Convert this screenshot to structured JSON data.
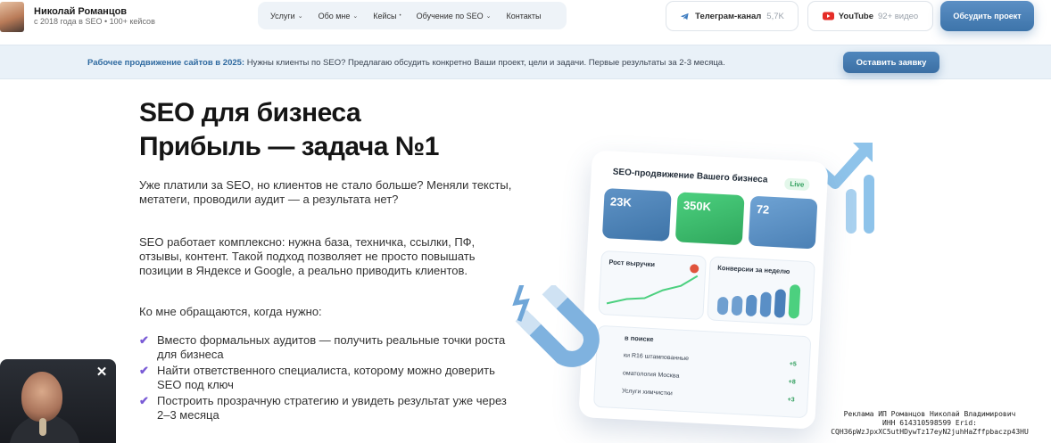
{
  "header": {
    "name": "Николай Романцов",
    "subtitle": "с 2018 года в SEO • 100+ кейсов",
    "nav": [
      {
        "label": "Услуги",
        "has_dropdown": true
      },
      {
        "label": "Обо мне",
        "has_dropdown": true
      },
      {
        "label": "Кейсы",
        "has_dropdown": false
      },
      {
        "label": "Обучение по SEO",
        "has_dropdown": true
      },
      {
        "label": "Контакты",
        "has_dropdown": false
      }
    ],
    "telegram": {
      "label": "Телеграм-канал",
      "count": "5,7K"
    },
    "youtube": {
      "label": "YouTube",
      "count": "92+ видео"
    },
    "cta": "Обсудить проект"
  },
  "promo": {
    "bold": "Рабочее продвижение сайтов в 2025:",
    "text": "Нужны клиенты по SEO? Предлагаю обсудить конкретно Ваши проект, цели и задачи. Первые результаты за 2-3 месяца.",
    "button": "Оставить заявку"
  },
  "hero": {
    "title_line1": "SEO для бизнеса",
    "title_line2": "Прибыль — задача №1",
    "p1": "Уже платили за SEO, но клиентов не стало больше? Меняли тексты, метатеги, проводили аудит — а результата нет?",
    "p2": "SEO работает комплексно: нужна база, техничка, ссылки, ПФ, отзывы, контент. Такой подход позволяет не просто повышать позиции в Яндексе и Google, а реально приводить клиентов.",
    "p3": "Ко мне обращаются, когда нужно:",
    "bullets": [
      "Вместо формальных аудитов — получить реальные точки роста для бизнеса",
      "Найти ответственного специалиста, которому можно доверить SEO под ключ",
      "Построить прозрачную стратегию и увидеть результат уже через 2–3 месяца"
    ]
  },
  "dashboard": {
    "title": "SEO-продвижение Вашего бизнеса",
    "live": "Live",
    "stats": [
      "23K",
      "350K",
      "72"
    ],
    "revenue_title": "Рост выручки",
    "conv_title": "Конверсии за неделю",
    "list_title": "в поиске",
    "list_rows": [
      {
        "label": "ки R16 штампованные",
        "delta": "+5"
      },
      {
        "label": "оматология Москва",
        "delta": "+8"
      },
      {
        "label": "Услуги химчистки",
        "delta": "+3"
      }
    ]
  },
  "ad": {
    "line1": "Реклама ИП Романцов Николай Владимирович",
    "line2": "ИНН 614310598599 Erid:",
    "line3": "CQH36pWzJpxXC5utHDywTz17eyN2juhHaZffpbaczp43HU"
  },
  "colors": {
    "accent": "#3d74aa",
    "promo_bg": "#e9f1f8",
    "check": "#7a5bd6",
    "green": "#2fa75c"
  }
}
